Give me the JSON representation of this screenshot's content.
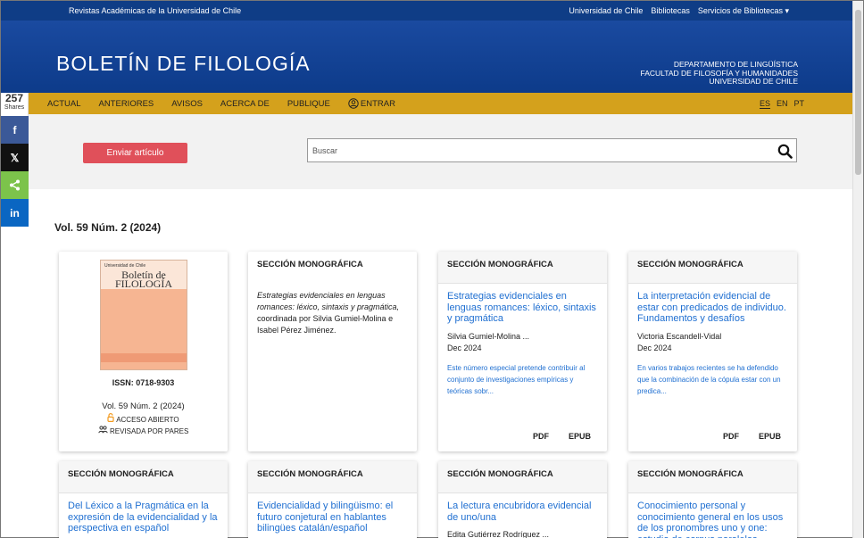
{
  "topbar": {
    "left": "Revistas Académicas de la Universidad de Chile",
    "links": [
      "Universidad de Chile",
      "Bibliotecas",
      "Servicios de Bibliotecas ▾"
    ]
  },
  "banner": {
    "title": "BOLETÍN DE FILOLOGÍA",
    "dept": [
      "DEPARTAMENTO DE LINGÜÍSTICA",
      "FACULTAD DE FILOSOFÍA Y HUMANIDADES",
      "UNIVERSIDAD DE CHILE"
    ]
  },
  "nav": {
    "items": [
      "ACTUAL",
      "ANTERIORES",
      "AVISOS",
      "ACERCA DE",
      "PUBLIQUE"
    ],
    "login": "ENTRAR",
    "langs": [
      "ES",
      "EN",
      "PT"
    ]
  },
  "toolbar": {
    "send": "Enviar artículo",
    "search_placeholder": "Buscar"
  },
  "share": {
    "count": "257",
    "label": "Shares",
    "buttons": [
      "f",
      "𝕏",
      "<",
      "in"
    ]
  },
  "volume": "Vol. 59 Núm. 2 (2024)",
  "issue_card": {
    "issn": "ISSN: 0718-9303",
    "vol": "Vol. 59 Núm. 2 (2024)",
    "open": "ACCESO ABIERTO",
    "peer": "REVISADA POR PARES",
    "cover_small": "Universidad de Chile",
    "cover_title": "Boletín de FILOLOGÍA"
  },
  "intro_card": {
    "head": "SECCIÓN MONOGRÁFICA",
    "italic": "Estrategias evidenciales en lenguas romances: léxico, sintaxis y pragmática,",
    "rest": " coordinada por Silvia Gumiel-Molina e Isabel Pérez Jiménez."
  },
  "articles_row1": [
    {
      "head": "SECCIÓN MONOGRÁFICA",
      "title": "Estrategias evidenciales en lenguas romances: léxico, sintaxis y pragmática",
      "author": "Silvia Gumiel-Molina ...",
      "date": "Dec 2024",
      "abstract": "Este número especial pretende contribuir al conjunto de investigaciones empíricas y teóricas sobr...",
      "pdf": "PDF",
      "epub": "EPUB"
    },
    {
      "head": "SECCIÓN MONOGRÁFICA",
      "title": "La interpretación evidencial de estar con predicados de individuo. Fundamentos y desafíos",
      "author": "Victoria Escandell-Vidal",
      "date": "Dec 2024",
      "abstract": "En varios trabajos recientes se ha defendido que la combinación de la cópula estar con un predica...",
      "pdf": "PDF",
      "epub": "EPUB"
    }
  ],
  "articles_row2": [
    {
      "head": "SECCIÓN MONOGRÁFICA",
      "title": "Del Léxico a la Pragmática en la expresión de la evidencialidad y la perspectiva en español"
    },
    {
      "head": "SECCIÓN MONOGRÁFICA",
      "title": "Evidencialidad y bilingüismo: el futuro conjetural en hablantes bilingües catalán/español"
    },
    {
      "head": "SECCIÓN MONOGRÁFICA",
      "title": "La lectura encubridora evidencial de uno/una",
      "author": "Edita Gutiérrez Rodríguez ..."
    },
    {
      "head": "SECCIÓN MONOGRÁFICA",
      "title": "Conocimiento personal y conocimiento general en los usos de los pronombres uno y one: estudio de corpus paralelos"
    }
  ],
  "colors": {
    "topbar": "#0f3d86",
    "nav": "#d4a11c",
    "send": "#e0505a",
    "link": "#1f6fd1",
    "facebook": "#3b5998",
    "x": "#111111",
    "sharethis": "#7cc34b",
    "linkedin": "#0a66c2"
  }
}
